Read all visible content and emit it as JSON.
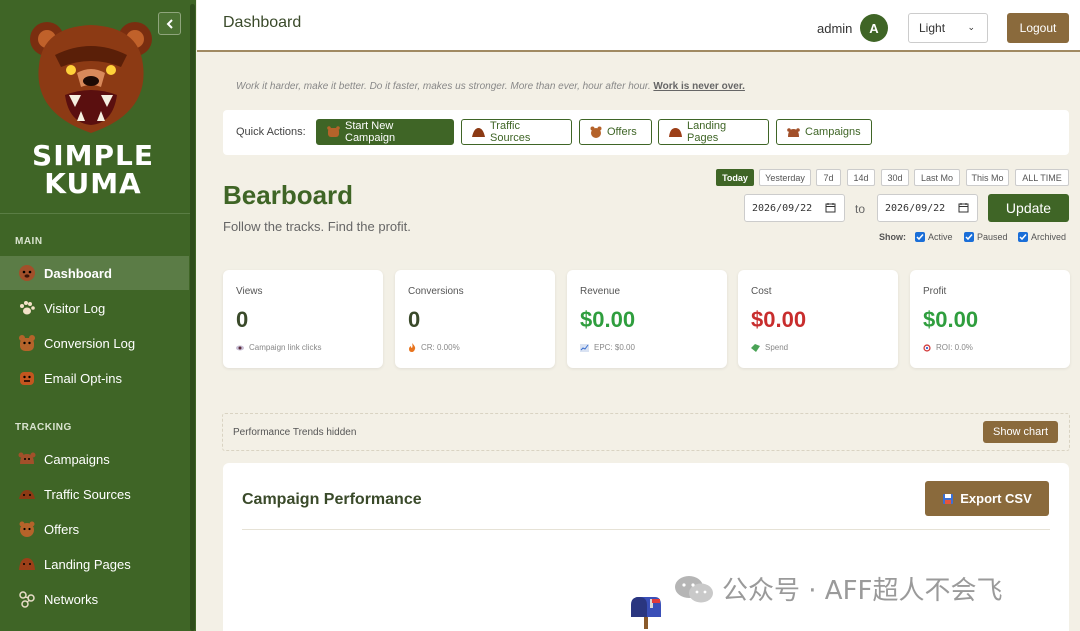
{
  "sidebar": {
    "brand_line1": "SIMPLE",
    "brand_line2": "KUMA",
    "section_main": "MAIN",
    "section_tracking": "TRACKING",
    "main_items": [
      {
        "label": "Dashboard",
        "icon": "bear-icon"
      },
      {
        "label": "Visitor Log",
        "icon": "paw-icon"
      },
      {
        "label": "Conversion Log",
        "icon": "bear-icon"
      },
      {
        "label": "Email Opt-ins",
        "icon": "bear-icon"
      }
    ],
    "tracking_items": [
      {
        "label": "Campaigns",
        "icon": "bear-icon"
      },
      {
        "label": "Traffic Sources",
        "icon": "bear-icon"
      },
      {
        "label": "Offers",
        "icon": "bear-icon"
      },
      {
        "label": "Landing Pages",
        "icon": "bear-icon"
      },
      {
        "label": "Networks",
        "icon": "network-icon"
      }
    ]
  },
  "topbar": {
    "title": "Dashboard",
    "username": "admin",
    "avatar_initial": "A",
    "theme": "Light",
    "logout": "Logout"
  },
  "quote": {
    "text": "Work it harder, make it better. Do it faster, makes us stronger. More than ever, hour after hour.",
    "emphasis": "Work is never over."
  },
  "quick_actions": {
    "label": "Quick Actions:",
    "buttons": [
      "Start New Campaign",
      "Traffic Sources",
      "Offers",
      "Landing Pages",
      "Campaigns"
    ]
  },
  "header": {
    "title": "Bearboard",
    "subtitle": "Follow the tracks. Find the profit."
  },
  "date_filter": {
    "ranges": [
      "Today",
      "Yesterday",
      "7d",
      "14d",
      "30d",
      "Last Mo",
      "This Mo",
      "ALL TIME"
    ],
    "active_range": "Today",
    "from": "2026/09/22",
    "to_label": "to",
    "to": "2026/09/22",
    "update": "Update",
    "show_label": "Show:",
    "show_options": [
      "Active",
      "Paused",
      "Archived"
    ]
  },
  "stats": [
    {
      "label": "Views",
      "value": "0",
      "sub": "Campaign link clicks"
    },
    {
      "label": "Conversions",
      "value": "0",
      "sub": "CR: 0.00%"
    },
    {
      "label": "Revenue",
      "value": "$0.00",
      "sub": "EPC: $0.00"
    },
    {
      "label": "Cost",
      "value": "$0.00",
      "sub": "Spend"
    },
    {
      "label": "Profit",
      "value": "$0.00",
      "sub": "ROI: 0.0%"
    }
  ],
  "performance_trends": {
    "text": "Performance Trends hidden",
    "button": "Show chart"
  },
  "campaign_performance": {
    "title": "Campaign Performance",
    "export": "Export CSV"
  },
  "watermark": "公众号 · AFF超人不会飞",
  "colors": {
    "sidebar_bg": "#3f6526",
    "accent_brown": "#8a6a3c",
    "positive": "#2f9e3e",
    "negative": "#c82d2d"
  }
}
